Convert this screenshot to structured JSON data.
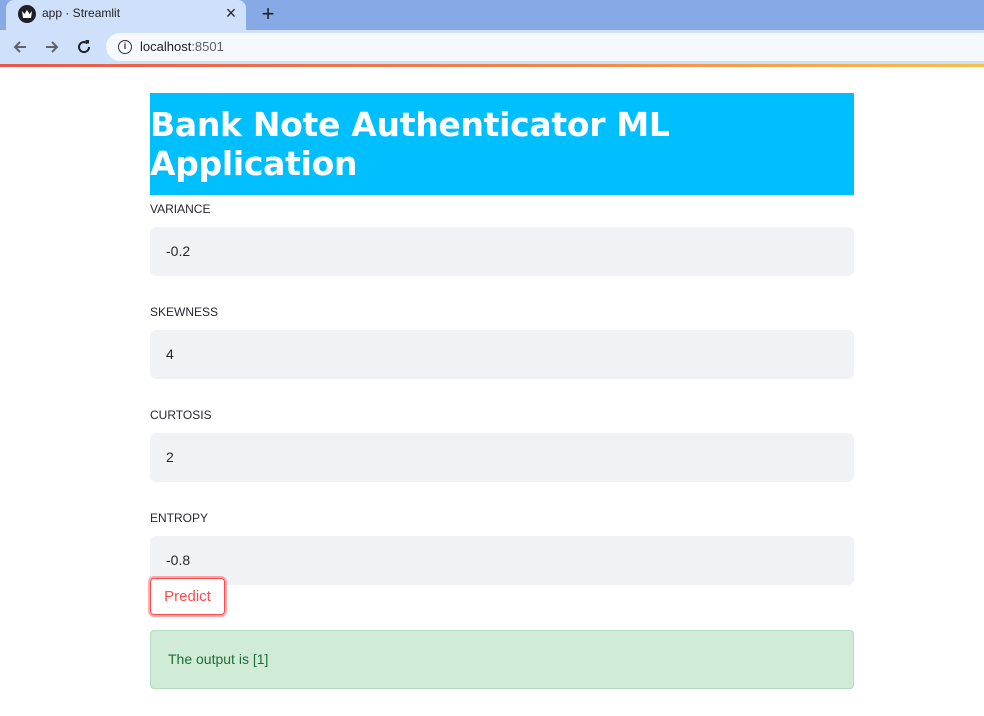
{
  "browser": {
    "tab_title": "app · Streamlit",
    "url_host": "localhost",
    "url_port": ":8501"
  },
  "app": {
    "title": "Bank Note Authenticator ML Application",
    "banner_color": "#00bfff",
    "fields": [
      {
        "label": "VARIANCE",
        "value": "-0.2"
      },
      {
        "label": "SKEWNESS",
        "value": "4"
      },
      {
        "label": "CURTOSIS",
        "value": "2"
      },
      {
        "label": "ENTROPY",
        "value": "-0.8"
      }
    ],
    "predict_label": "Predict",
    "output_text": "The output is [1]"
  }
}
